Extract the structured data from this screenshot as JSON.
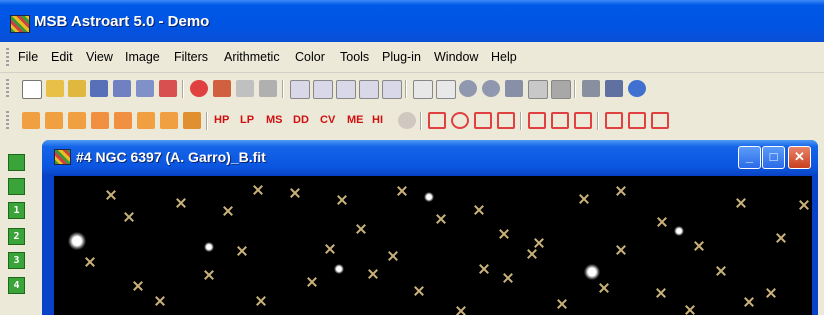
{
  "app": {
    "title": "MSB Astroart 5.0 - Demo"
  },
  "menu": [
    "File",
    "Edit",
    "View",
    "Image",
    "Filters",
    "Arithmetic",
    "Color",
    "Tools",
    "Plug-in",
    "Window",
    "Help"
  ],
  "toolbar2_text_buttons": [
    "HP",
    "LP",
    "MS",
    "DD",
    "CV",
    "ME",
    "HI"
  ],
  "side_tools": [
    "",
    "",
    "1",
    "2",
    "3",
    "4"
  ],
  "child_window": {
    "title": "#4 NGC 6397 (A. Garro)_B.fit",
    "minimize_glyph": "_",
    "maximize_glyph": "□",
    "close_glyph": "✕"
  },
  "colors": {
    "xp_blue": "#0054e3",
    "face": "#ece9d8",
    "star_mark": "#c8b07a"
  }
}
